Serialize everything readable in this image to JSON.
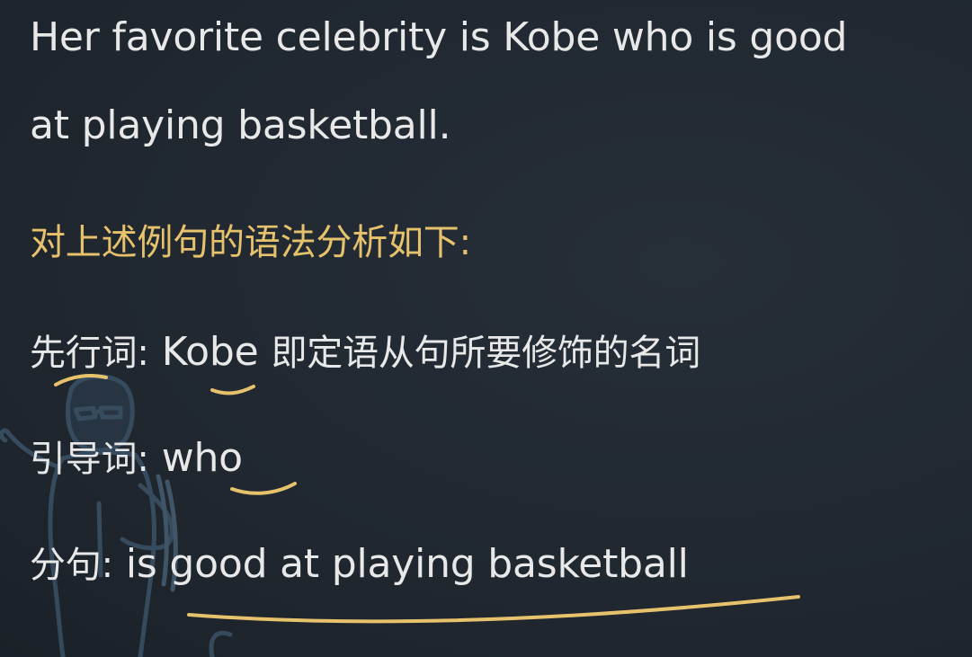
{
  "sentence": {
    "line1": "Her favorite celebrity is Kobe who is good",
    "line2": "at playing basketball."
  },
  "analysis": {
    "heading": "对上述例句的语法分析如下:",
    "antecedent": {
      "label": "先行词:",
      "word": "Kobe",
      "desc": "即定语从句所要修饰的名词"
    },
    "relative": {
      "label": "引导词:",
      "word": "who"
    },
    "clause": {
      "label": "分句:",
      "text": "is good at playing basketball"
    }
  },
  "colors": {
    "background": "#222a33",
    "text": "#e8e8e8",
    "accent": "#e6c26c"
  },
  "icons": [
    "teacher-figure-illustration",
    "underline-annotation"
  ]
}
